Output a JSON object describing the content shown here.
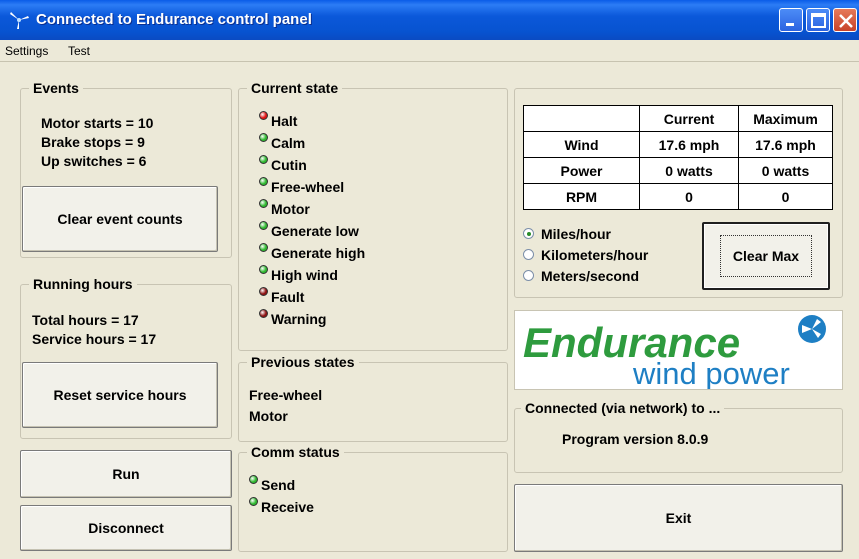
{
  "window": {
    "title": "Connected to Endurance control panel"
  },
  "menu": {
    "items": [
      "Settings",
      "Test"
    ]
  },
  "events": {
    "title": "Events",
    "lines": [
      "Motor starts = 10",
      "Brake stops = 9",
      "Up switches = 6"
    ],
    "clear_button": "Clear event counts"
  },
  "running_hours": {
    "title": "Running hours",
    "lines": [
      "Total hours = 17",
      "Service hours = 17"
    ],
    "reset_button": "Reset service hours"
  },
  "buttons": {
    "run": "Run",
    "disconnect": "Disconnect",
    "clear_max": "Clear Max",
    "exit": "Exit"
  },
  "current_state": {
    "title": "Current state",
    "states": [
      {
        "label": "Halt",
        "color": "#E01010"
      },
      {
        "label": "Calm",
        "color": "#2EB82E"
      },
      {
        "label": "Cutin",
        "color": "#2EB82E"
      },
      {
        "label": "Free-wheel",
        "color": "#2EB82E"
      },
      {
        "label": "Motor",
        "color": "#2EB82E"
      },
      {
        "label": "Generate low",
        "color": "#2EB82E"
      },
      {
        "label": "Generate high",
        "color": "#2EB82E"
      },
      {
        "label": "High wind",
        "color": "#2EB82E"
      },
      {
        "label": "Fault",
        "color": "#8E1212"
      },
      {
        "label": "Warning",
        "color": "#8E1212"
      }
    ]
  },
  "previous_states": {
    "title": "Previous states",
    "items": [
      "Free-wheel",
      "Motor"
    ]
  },
  "comm_status": {
    "title": "Comm status",
    "items": [
      {
        "label": "Send",
        "color": "#2EB82E"
      },
      {
        "label": "Receive",
        "color": "#2EB82E"
      }
    ]
  },
  "measurements": {
    "headers": [
      "",
      "Current",
      "Maximum"
    ],
    "rows": [
      [
        "Wind",
        "17.6 mph",
        "17.6 mph"
      ],
      [
        "Power",
        "0 watts",
        "0 watts"
      ],
      [
        "RPM",
        "0",
        "0"
      ]
    ]
  },
  "units": {
    "options": [
      "Miles/hour",
      "Kilometers/hour",
      "Meters/second"
    ],
    "selected": "Miles/hour"
  },
  "logo": {
    "name": "Endurance",
    "tagline": "wind power"
  },
  "connection": {
    "title": "Connected (via network) to ...",
    "version": "Program version 8.0.9"
  },
  "colors": {
    "titlebar": "#0753D0",
    "logo_green": "#2E9B3E",
    "logo_blue": "#1E7FC4"
  }
}
